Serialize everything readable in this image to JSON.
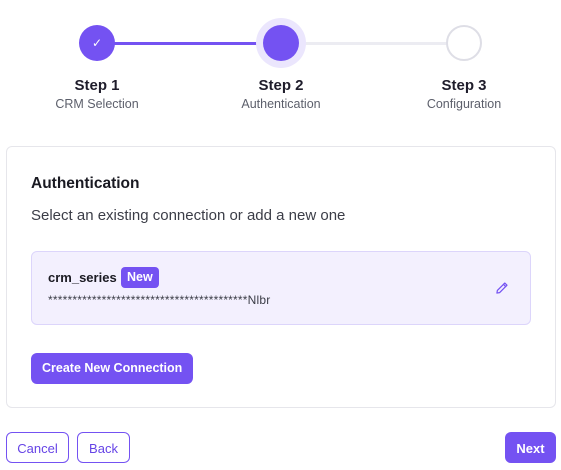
{
  "stepper": {
    "steps": [
      {
        "title": "Step 1",
        "subtitle": "CRM Selection",
        "status": "completed",
        "icon": "check-icon",
        "icon_glyph": "✓"
      },
      {
        "title": "Step 2",
        "subtitle": "Authentication",
        "status": "active"
      },
      {
        "title": "Step 3",
        "subtitle": "Configuration",
        "status": "pending"
      }
    ]
  },
  "auth_card": {
    "title": "Authentication",
    "subtitle": "Select an existing connection or add a new one",
    "connection": {
      "name": "crm_series",
      "badge": "New",
      "masked_key": "*****************************************Nlbr",
      "edit_icon": "pencil-icon"
    },
    "create_button_label": "Create New Connection"
  },
  "footer": {
    "cancel_label": "Cancel",
    "back_label": "Back",
    "next_label": "Next"
  },
  "colors": {
    "accent": "#7452f2",
    "accent_light": "#f3f0fe",
    "accent_border": "#dcd5fb",
    "track_inactive": "#ececf2"
  }
}
